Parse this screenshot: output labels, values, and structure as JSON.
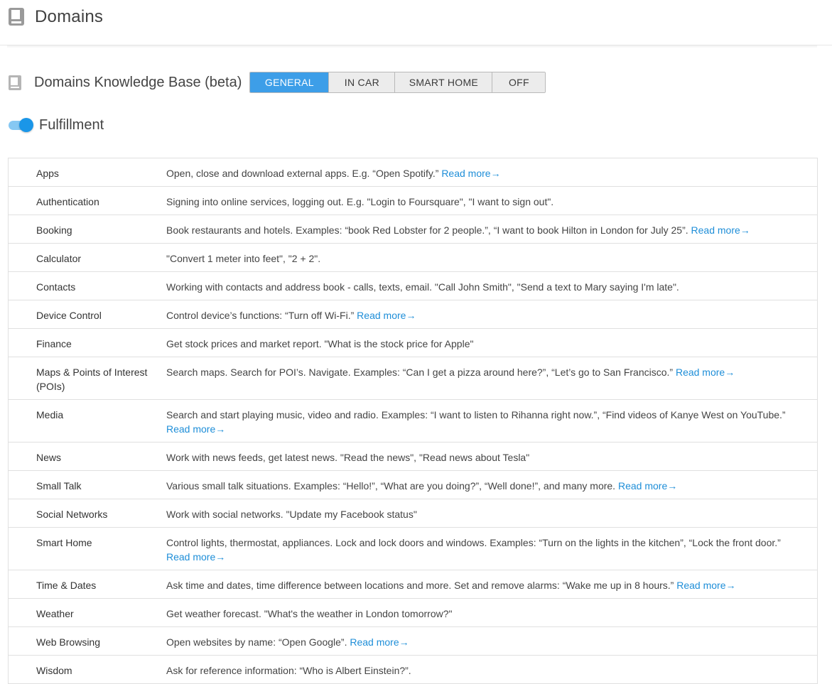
{
  "header": {
    "title": "Domains",
    "icon": "book-icon"
  },
  "knowledge_base": {
    "title": "Domains Knowledge Base (beta)",
    "icon": "book-icon",
    "options": [
      "GENERAL",
      "IN CAR",
      "SMART HOME",
      "OFF"
    ],
    "selected": "GENERAL",
    "accent_color": "#3d9ee8"
  },
  "fulfillment": {
    "label": "Fulfillment",
    "enabled": true
  },
  "read_more_label": "Read more",
  "read_more_arrow": "→",
  "domains": [
    {
      "name": "Apps",
      "desc": "Open, close and download external apps. E.g. “Open Spotify.”",
      "read_more": true
    },
    {
      "name": "Authentication",
      "desc": "Signing into online services, logging out. E.g. \"Login to Foursquare\", \"I want to sign out\".",
      "read_more": false
    },
    {
      "name": "Booking",
      "desc": "Book restaurants and hotels. Examples: “book Red Lobster for 2 people.”, “I want to book Hilton in London for July 25”.",
      "read_more": true
    },
    {
      "name": "Calculator",
      "desc": "\"Convert 1 meter into feet\", \"2 + 2\".",
      "read_more": false
    },
    {
      "name": "Contacts",
      "desc": "Working with contacts and address book - calls, texts, email. \"Call John Smith\", \"Send a text to Mary saying I'm late\".",
      "read_more": false
    },
    {
      "name": "Device Control",
      "desc": "Control device’s functions: “Turn off Wi-Fi.”",
      "read_more": true
    },
    {
      "name": "Finance",
      "desc": "Get stock prices and market report. \"What is the stock price for Apple\"",
      "read_more": false
    },
    {
      "name": "Maps & Points of Interest (POIs)",
      "desc": "Search maps. Search for POI’s. Navigate. Examples: “Can I get a pizza around here?”, “Let’s go to San Francisco.”",
      "read_more": true,
      "tall": true
    },
    {
      "name": "Media",
      "desc": "Search and start playing music, video and radio. Examples: “I want to listen to Rihanna right now.”, “Find videos of Kanye West on YouTube.”",
      "read_more": true,
      "tall": true
    },
    {
      "name": "News",
      "desc": "Work with news feeds, get latest news. \"Read the news\", \"Read news about Tesla\"",
      "read_more": false
    },
    {
      "name": "Small Talk",
      "desc": "Various small talk situations. Examples: “Hello!”, “What are you doing?”, “Well done!”, and many more.",
      "read_more": true
    },
    {
      "name": "Social Networks",
      "desc": "Work with social networks. \"Update my Facebook status\"",
      "read_more": false
    },
    {
      "name": "Smart Home",
      "desc": "Control lights, thermostat, appliances. Lock and lock doors and windows. Examples: “Turn on the lights in the kitchen”, “Lock the front door.”",
      "read_more": true,
      "tall": true
    },
    {
      "name": "Time & Dates",
      "desc": "Ask time and dates, time difference between locations and more. Set and remove alarms: “Wake me up in 8 hours.”",
      "read_more": true
    },
    {
      "name": "Weather",
      "desc": "Get weather forecast. \"What's the weather in London tomorrow?\"",
      "read_more": false
    },
    {
      "name": "Web Browsing",
      "desc": "Open websites by name: “Open Google”.",
      "read_more": true
    },
    {
      "name": "Wisdom",
      "desc": "Ask for reference information: “Who is Albert Einstein?”.",
      "read_more": false
    }
  ]
}
